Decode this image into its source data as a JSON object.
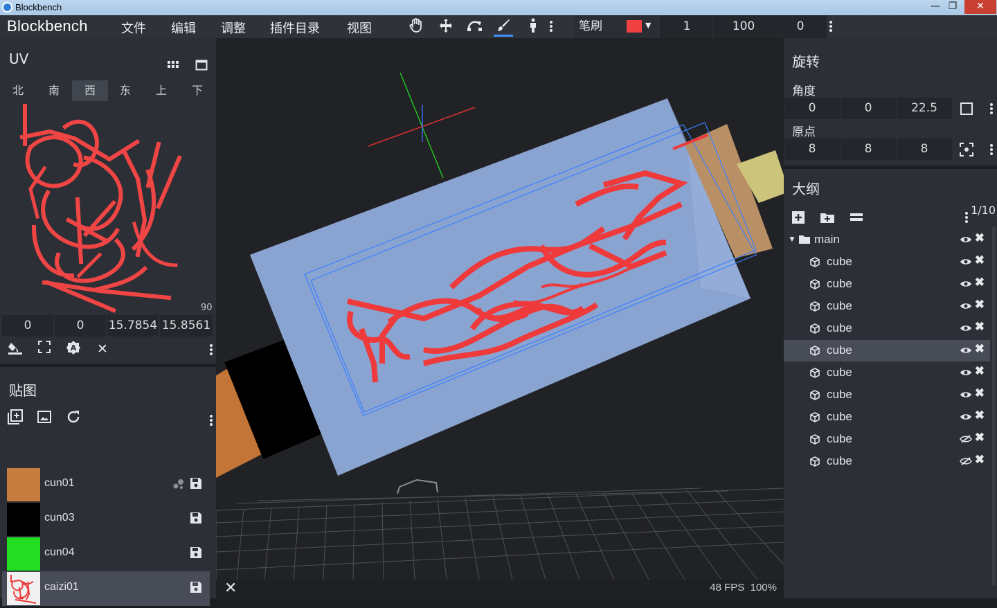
{
  "window": {
    "title": "Blockbench",
    "controls": [
      "—",
      "❐",
      "✕"
    ]
  },
  "menubar": {
    "brand": "Blockbench",
    "items": [
      "文件",
      "编辑",
      "调整",
      "插件目录",
      "视图"
    ],
    "tools": [
      {
        "name": "hand-tool-icon",
        "glyph": "✋"
      },
      {
        "name": "move-tool-icon",
        "glyph": "✥"
      },
      {
        "name": "rotate-tool-icon",
        "glyph": "↷"
      },
      {
        "name": "brush-tool-icon",
        "glyph": "🖌"
      },
      {
        "name": "pose-tool-icon",
        "glyph": "♙"
      }
    ],
    "brush_label": "笔刷",
    "brush_color": "#f04040",
    "brush_size": "1",
    "brush_opacity": "100",
    "brush_softness": "0"
  },
  "uv": {
    "title": "UV",
    "faces": [
      "北",
      "南",
      "西",
      "东",
      "上",
      "下"
    ],
    "active_face": "西",
    "size_label": "90",
    "inputs": [
      "0",
      "0",
      "15.7854",
      "15.8561"
    ]
  },
  "textures": {
    "title": "贴图",
    "items": [
      {
        "name": "cun01",
        "color": "#c87d40",
        "selected": false
      },
      {
        "name": "cun03",
        "color": "#000000",
        "selected": false
      },
      {
        "name": "cun04",
        "color": "#22dd22",
        "selected": false
      },
      {
        "name": "caizi01",
        "color": "#e8e8e8",
        "selected": true
      }
    ]
  },
  "viewport": {
    "fps": "48 FPS",
    "zoom": "100%"
  },
  "rotation": {
    "title": "旋转",
    "angle_label": "角度",
    "angle": [
      "0",
      "0",
      "22.5"
    ],
    "origin_label": "原点",
    "origin": [
      "8",
      "8",
      "8"
    ]
  },
  "outliner": {
    "title": "大纲",
    "counter": "1/10",
    "group": "main",
    "cubes": [
      {
        "label": "cube",
        "visible": true,
        "selected": false
      },
      {
        "label": "cube",
        "visible": true,
        "selected": false
      },
      {
        "label": "cube",
        "visible": true,
        "selected": false
      },
      {
        "label": "cube",
        "visible": true,
        "selected": false
      },
      {
        "label": "cube",
        "visible": true,
        "selected": true
      },
      {
        "label": "cube",
        "visible": true,
        "selected": false
      },
      {
        "label": "cube",
        "visible": true,
        "selected": false
      },
      {
        "label": "cube",
        "visible": true,
        "selected": false
      },
      {
        "label": "cube",
        "visible": false,
        "selected": false
      },
      {
        "label": "cube",
        "visible": false,
        "selected": false
      }
    ]
  }
}
